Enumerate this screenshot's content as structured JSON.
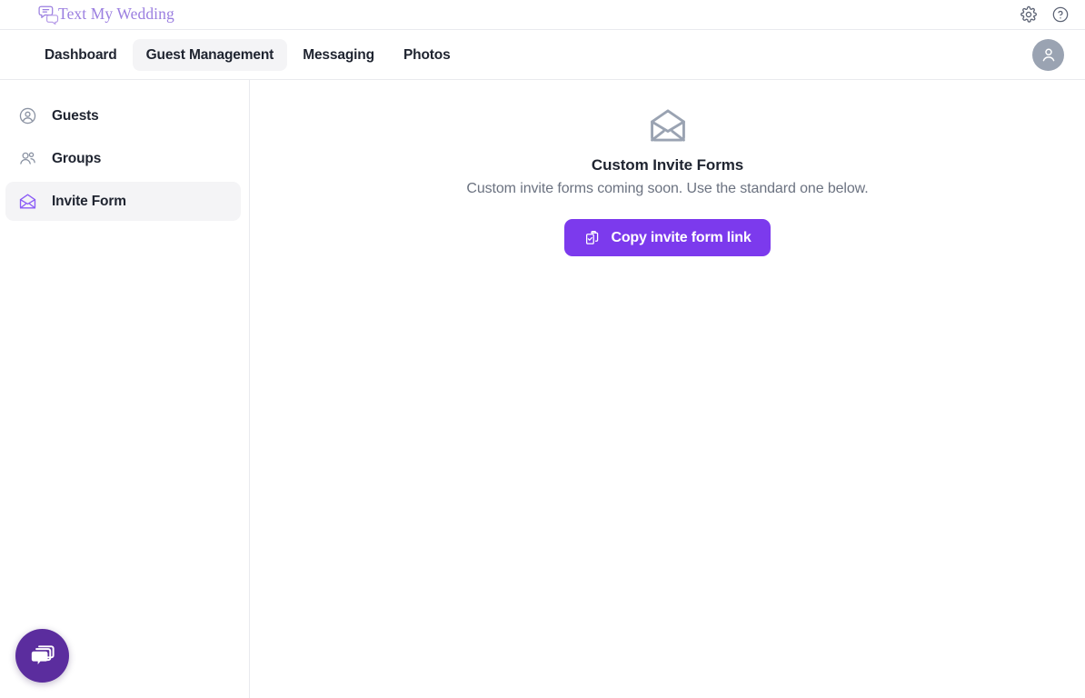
{
  "brand": {
    "name": "Text My Wedding",
    "logo_icon": "chat-bubbles-icon",
    "color": "#9b7fe0"
  },
  "brandbar": {
    "settings_icon": "gear-icon",
    "help_icon": "question-circle-icon"
  },
  "nav": {
    "tabs": [
      {
        "label": "Dashboard",
        "active": false
      },
      {
        "label": "Guest Management",
        "active": true
      },
      {
        "label": "Messaging",
        "active": false
      },
      {
        "label": "Photos",
        "active": false
      }
    ],
    "avatar_icon": "user-avatar-icon"
  },
  "sidebar": {
    "items": [
      {
        "label": "Guests",
        "icon": "user-circle-icon",
        "active": false
      },
      {
        "label": "Groups",
        "icon": "users-icon",
        "active": false
      },
      {
        "label": "Invite Form",
        "icon": "open-envelope-icon",
        "active": true
      }
    ]
  },
  "main": {
    "icon": "open-envelope-icon",
    "title": "Custom Invite Forms",
    "description": "Custom invite forms coming soon. Use the standard one below.",
    "button": {
      "label": "Copy invite form link",
      "icon": "copy-clipboard-icon",
      "color": "#7c3aed"
    }
  },
  "chat_widget": {
    "icon": "chat-bubbles-icon",
    "color": "#5b2d9e"
  }
}
